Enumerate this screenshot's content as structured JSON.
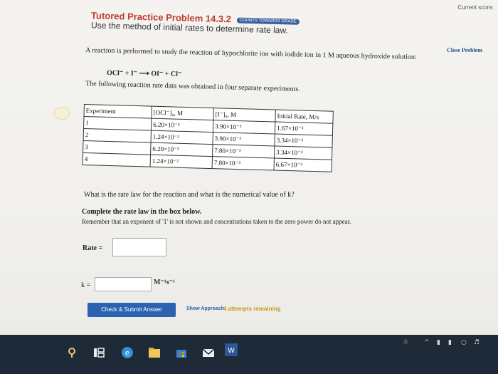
{
  "header": {
    "score_label": "Current score:",
    "title": "Tutored Practice Problem 14.3.2",
    "badge": "COUNTS TOWARDS GRADE",
    "subtitle": "Use the method of initial rates to determine rate law.",
    "close_label": "Close Problem"
  },
  "problem": {
    "intro": "A reaction is performed to study the reaction of hypochlorite ion with iodide ion in 1 M aqueous hydroxide solution:",
    "equation": "OCl⁻ + I⁻ ⟶ OI⁻ + Cl⁻",
    "lead": "The following reaction rate data was obtained in four separate experiments."
  },
  "table": {
    "headers": [
      "Experiment",
      "[OCl⁻]₀, M",
      "[I⁻]₀, M",
      "Initial Rate, M/s"
    ],
    "rows": [
      [
        "1",
        "6.20×10⁻³",
        "3.90×10⁻³",
        "1.67×10⁻³"
      ],
      [
        "2",
        "1.24×10⁻²",
        "3.90×10⁻³",
        "3.34×10⁻³"
      ],
      [
        "3",
        "6.20×10⁻³",
        "7.80×10⁻³",
        "3.34×10⁻³"
      ],
      [
        "4",
        "1.24×10⁻²",
        "7.80×10⁻³",
        "6.67×10⁻³"
      ]
    ]
  },
  "question": {
    "text": "What is the rate law for the reaction and what is the numerical value of k?",
    "complete": "Complete the rate law in the box below.",
    "remember": "Remember that an exponent of '1' is not shown and concentrations taken to the zero power do not appear.",
    "rate_label": "Rate =",
    "rate_value": "",
    "k_label": "k =",
    "k_value": "",
    "k_units": "M⁻¹s⁻¹"
  },
  "actions": {
    "submit": "Check & Submit Answer",
    "approach": "Show Approach",
    "attempts": "4 attempts remaining"
  },
  "colors": {
    "title": "#c0392b",
    "link": "#2a4f8a",
    "button": "#2c63b0",
    "attempts": "#c79a18",
    "taskbar": "#1e2a38"
  },
  "taskbar": {
    "icons": [
      "search-icon",
      "task-view-icon",
      "edge-icon",
      "file-explorer-icon",
      "store-icon",
      "mail-icon",
      "word-icon"
    ],
    "word_label": "W"
  }
}
